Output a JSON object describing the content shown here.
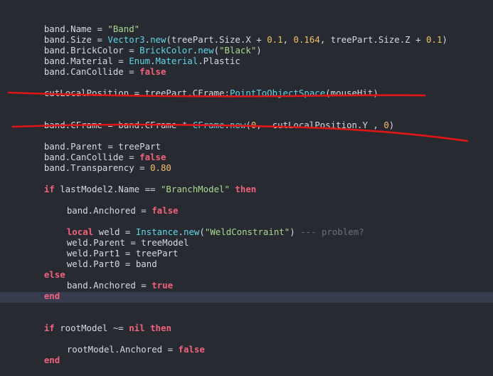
{
  "colors": {
    "background": "#282a32",
    "default_text": "#d7d9de",
    "string": "#a9d98f",
    "number": "#f1c067",
    "builtin": "#5fd6e6",
    "keyword": "#f2627b",
    "comment": "#6b6f7a",
    "current_line": "#363b4e",
    "annotation_red": "#e01616"
  },
  "code": {
    "line_1": [
      "band.Name = ",
      "\"Band\""
    ],
    "line_2": [
      "band.Size = ",
      "Vector3",
      ".",
      "new",
      "(treePart.Size.X + ",
      "0.1",
      ", ",
      "0.164",
      ", treePart.Size.Z + ",
      "0.1",
      ")"
    ],
    "line_3": [
      "band.BrickColor = ",
      "BrickColor",
      ".",
      "new",
      "(",
      "\"Black\"",
      ")"
    ],
    "line_4": [
      "band.Material = ",
      "Enum",
      ".",
      "Material",
      ".Plastic"
    ],
    "line_5": [
      "band.CanCollide = ",
      "false"
    ],
    "line_6": [
      "cutLocalPosition = treePart.CFrame:",
      "PointToObjectSpace",
      "(mouseHit)"
    ],
    "line_7": [
      "band.CFrame = band.CFrame * ",
      "CFrame",
      ".",
      "new",
      "(",
      "0",
      ",  cutLocalPosition.Y , ",
      "0",
      ")"
    ],
    "line_8": [
      "band.Parent = treePart"
    ],
    "line_9": [
      "band.CanCollide = ",
      "false"
    ],
    "line_10": [
      "band.Transparency = ",
      "0.80"
    ],
    "line_11": [
      "if",
      " lastModel2.Name == ",
      "\"BranchModel\"",
      " ",
      "then"
    ],
    "line_12": [
      "band.Anchored = ",
      "false"
    ],
    "line_13": [
      "local",
      " weld = ",
      "Instance",
      ".",
      "new",
      "(",
      "\"WeldConstraint\"",
      ") ",
      "--- problem?"
    ],
    "line_14": [
      "weld.Parent = treeModel"
    ],
    "line_15": [
      "weld.Part1 = treePart"
    ],
    "line_16": [
      "weld.Part0 = band"
    ],
    "line_17": [
      "else"
    ],
    "line_18": [
      "band.Anchored = ",
      "true"
    ],
    "line_19": [
      "end"
    ],
    "line_20": [
      "if",
      " rootModel ~= ",
      "nil",
      " ",
      "then"
    ],
    "line_21": [
      "rootModel.Anchored = ",
      "false"
    ],
    "line_22": [
      "end"
    ]
  }
}
